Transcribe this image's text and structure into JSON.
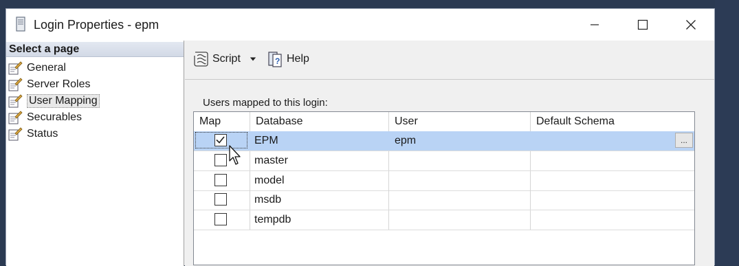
{
  "window": {
    "title": "Login Properties - epm"
  },
  "sidebar": {
    "header": "Select a page",
    "items": [
      {
        "label": "General",
        "selected": false
      },
      {
        "label": "Server Roles",
        "selected": false
      },
      {
        "label": "User Mapping",
        "selected": true
      },
      {
        "label": "Securables",
        "selected": false
      },
      {
        "label": "Status",
        "selected": false
      }
    ]
  },
  "toolbar": {
    "script_label": "Script",
    "help_label": "Help"
  },
  "panel": {
    "users_label": "Users mapped to this login:",
    "columns": [
      "Map",
      "Database",
      "User",
      "Default Schema"
    ],
    "rows": [
      {
        "map": true,
        "database": "EPM",
        "user": "epm",
        "schema": "",
        "selected": true
      },
      {
        "map": false,
        "database": "master",
        "user": "",
        "schema": "",
        "selected": false
      },
      {
        "map": false,
        "database": "model",
        "user": "",
        "schema": "",
        "selected": false
      },
      {
        "map": false,
        "database": "msdb",
        "user": "",
        "schema": "",
        "selected": false
      },
      {
        "map": false,
        "database": "tempdb",
        "user": "",
        "schema": "",
        "selected": false
      }
    ],
    "ellipsis": "..."
  }
}
